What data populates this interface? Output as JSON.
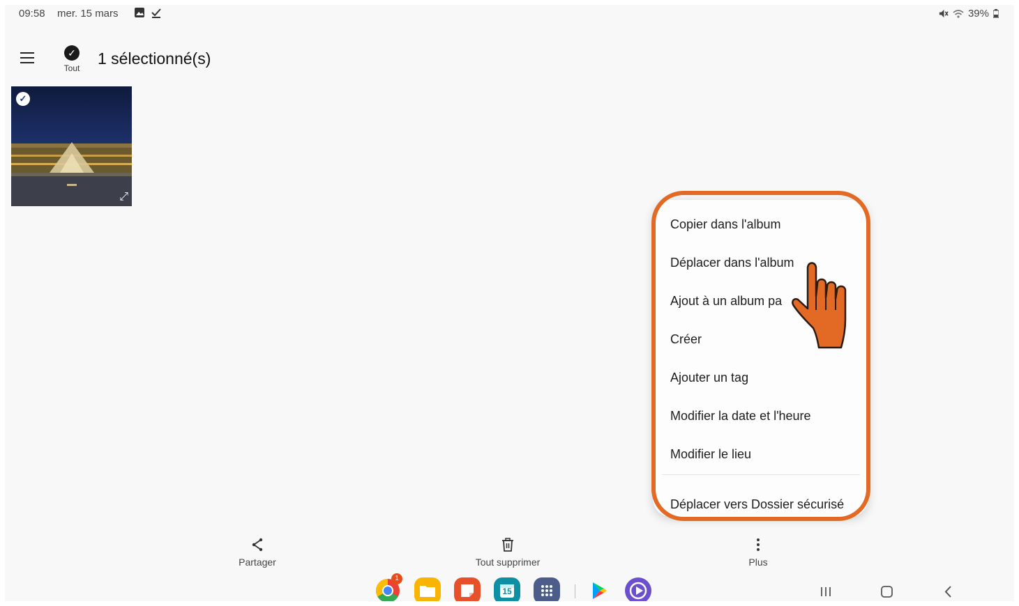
{
  "status_bar": {
    "time": "09:58",
    "date": "mer. 15 mars",
    "battery": "39%",
    "icons": [
      "gallery-icon",
      "check-download-icon",
      "mute-icon",
      "wifi-icon",
      "battery-icon"
    ]
  },
  "header": {
    "select_all_label": "Tout",
    "title": "1 sélectionné(s)"
  },
  "thumbnail": {
    "subject": "photo-louvre-pyramid",
    "selected": true
  },
  "context_menu": {
    "items": [
      "Copier dans l'album",
      "Déplacer dans l'album",
      "Ajout à un album pa",
      "Créer",
      "Ajouter un tag",
      "Modifier la date et l'heure",
      "Modifier le lieu"
    ],
    "secure_item": "Déplacer vers Dossier sécurisé"
  },
  "bottom_actions": {
    "share": "Partager",
    "delete_all": "Tout supprimer",
    "more": "Plus"
  },
  "dock": {
    "apps": [
      "chrome-icon",
      "my-files-icon",
      "samsung-notes-icon",
      "calendar-icon",
      "apps-grid-icon",
      "play-store-icon",
      "screen-recorder-icon"
    ],
    "chrome_badge": "1",
    "calendar_day": "15"
  },
  "colors": {
    "highlight": "#e26a24",
    "hand": "#e26a24",
    "background": "#f8f8f8"
  }
}
